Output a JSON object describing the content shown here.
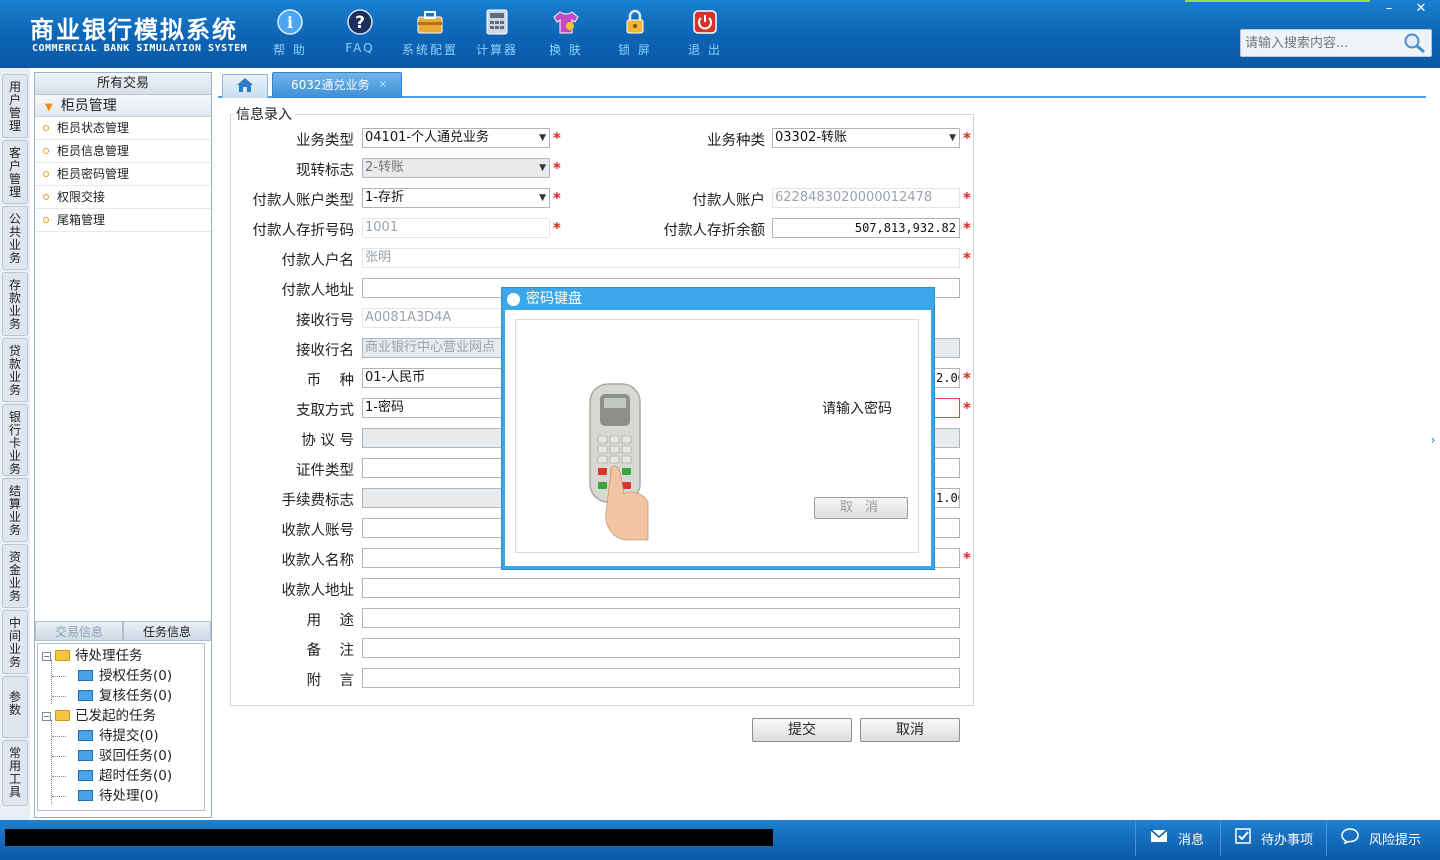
{
  "app": {
    "title_cn": "商业银行模拟系统",
    "title_en": "COMMERCIAL BANK SIMULATION SYSTEM"
  },
  "toolbar": [
    {
      "name": "help",
      "label": "帮 助",
      "icon": "info-icon"
    },
    {
      "name": "faq",
      "label": "FAQ",
      "icon": "question-icon"
    },
    {
      "name": "sys-config",
      "label": "系统配置",
      "icon": "toolbox-icon"
    },
    {
      "name": "calculator",
      "label": "计算器",
      "icon": "calculator-icon"
    },
    {
      "name": "skin",
      "label": "换 肤",
      "icon": "shirt-icon"
    },
    {
      "name": "lock",
      "label": "锁 屏",
      "icon": "lock-icon"
    },
    {
      "name": "exit",
      "label": "退 出",
      "icon": "power-icon"
    }
  ],
  "window": {
    "minimize": "–",
    "close": "✕"
  },
  "search": {
    "placeholder": "请输入搜索内容..."
  },
  "vnav": [
    "用\n户\n管\n理",
    "客\n户\n管\n理",
    "公\n共\n业\n务",
    "存\n款\n业\n务",
    "贷\n款\n业\n务",
    "银\n行\n卡\n业\n务",
    "结\n算\n业\n务",
    "资\n金\n业\n务",
    "中\n间\n业\n务",
    "参\n数",
    "常\n用\n工\n具"
  ],
  "left_panel": {
    "header": "所有交易",
    "group": "柜员管理",
    "items": [
      "柜员状态管理",
      "柜员信息管理",
      "柜员密码管理",
      "权限交接",
      "尾箱管理"
    ],
    "tabs": [
      "交易信息",
      "任务信息"
    ],
    "tree": {
      "pending": "待处理任务",
      "pending_children": [
        "授权任务(0)",
        "复核任务(0)"
      ],
      "initiated": "已发起的任务",
      "initiated_children": [
        "待提交(0)",
        "驳回任务(0)",
        "超时任务(0)",
        "待处理(0)"
      ]
    }
  },
  "tabs": {
    "active": "6032通兑业务",
    "close": "×"
  },
  "form": {
    "legend": "信息录入",
    "labels": {
      "biz_type": "业务类型",
      "cash_flag": "现转标志",
      "payer_acct_type": "付款人账户类型",
      "payer_book_no": "付款人存折号码",
      "payer_name": "付款人户名",
      "payer_addr": "付款人地址",
      "recv_bank_no": "接收行号",
      "recv_bank_name": "接收行名",
      "currency": "币    种",
      "withdraw_method": "支取方式",
      "agreement_no": "协 议 号",
      "id_type": "证件类型",
      "fee_flag": "手续费标志",
      "payee_acct": "收款人账号",
      "payee_name": "收款人名称",
      "payee_addr": "收款人地址",
      "purpose": "用    途",
      "remark": "备    注",
      "postscript": "附    言",
      "biz_kind": "业务种类",
      "payer_acct": "付款人账户",
      "payer_balance": "付款人存折余额"
    },
    "values": {
      "biz_type": "04101-个人通兑业务",
      "cash_flag": "2-转账",
      "payer_acct_type": "1-存折",
      "payer_book_no": "1001",
      "payer_name": "张明",
      "recv_bank_no": "A0081A3D4A",
      "recv_bank_name": "商业银行中心营业网点",
      "currency": "01-人民币",
      "withdraw_method": "1-密码",
      "biz_kind": "03302-转账",
      "payer_acct": "6228483020000012478",
      "payer_balance": "507,813,932.82",
      "amount_partial": "2.00",
      "fee_partial": "1.00"
    }
  },
  "buttons": {
    "submit": "提交",
    "cancel": "取消"
  },
  "modal": {
    "title": "密码键盘",
    "prompt": "请输入密码",
    "cancel": "取 消"
  },
  "statusbar": {
    "message": "消息",
    "todo": "待办事项",
    "risk": "风险提示"
  },
  "colors": {
    "header_blue": "#0e64b4",
    "accent": "#3ba7ea",
    "required": "#e02020"
  }
}
